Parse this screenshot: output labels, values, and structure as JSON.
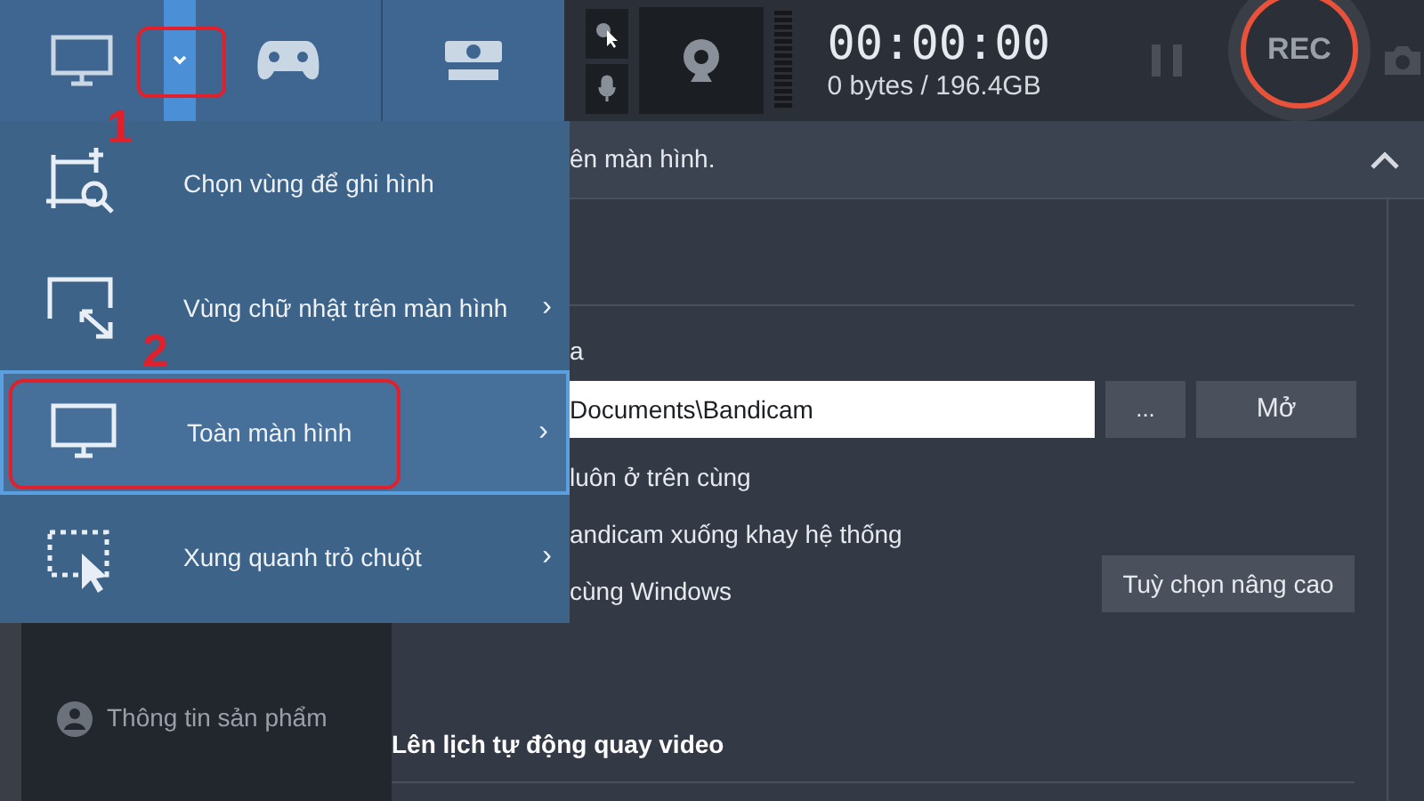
{
  "toolbar": {
    "mode_dropdown": {
      "expanded": true,
      "annotation": "1"
    },
    "timer": "00:00:00",
    "file_size": "0 bytes / 196.4GB",
    "rec_button": "REC"
  },
  "mode_menu": [
    {
      "kind": "select-area",
      "label": "Chọn vùng để ghi hình",
      "submenu": false,
      "selected": false
    },
    {
      "kind": "rectangle",
      "label": "Vùng chữ nhật trên màn hình",
      "submenu": true,
      "selected": false
    },
    {
      "kind": "fullscreen",
      "label": "Toàn màn hình",
      "submenu": true,
      "selected": true,
      "annotation": "2"
    },
    {
      "kind": "around-mouse",
      "label": "Xung quanh trỏ chuột",
      "submenu": true,
      "selected": false
    }
  ],
  "submenu_arrow": "›",
  "sidebar": {
    "items": [
      {
        "label": "Thông tin sản phẩm"
      }
    ]
  },
  "main": {
    "header_visible_text": "ên màn hình.",
    "output_label_visible_text": "a",
    "output_path_visible_text": "Documents\\Bandicam",
    "browse_button": "...",
    "open_button": "Mở",
    "option_visible_texts": [
      "luôn ở trên cùng",
      "andicam xuống khay hệ thống",
      "cùng Windows"
    ],
    "advanced_button": "Tuỳ chọn nâng cao",
    "schedule_heading": "Lên lịch tự động quay video"
  }
}
